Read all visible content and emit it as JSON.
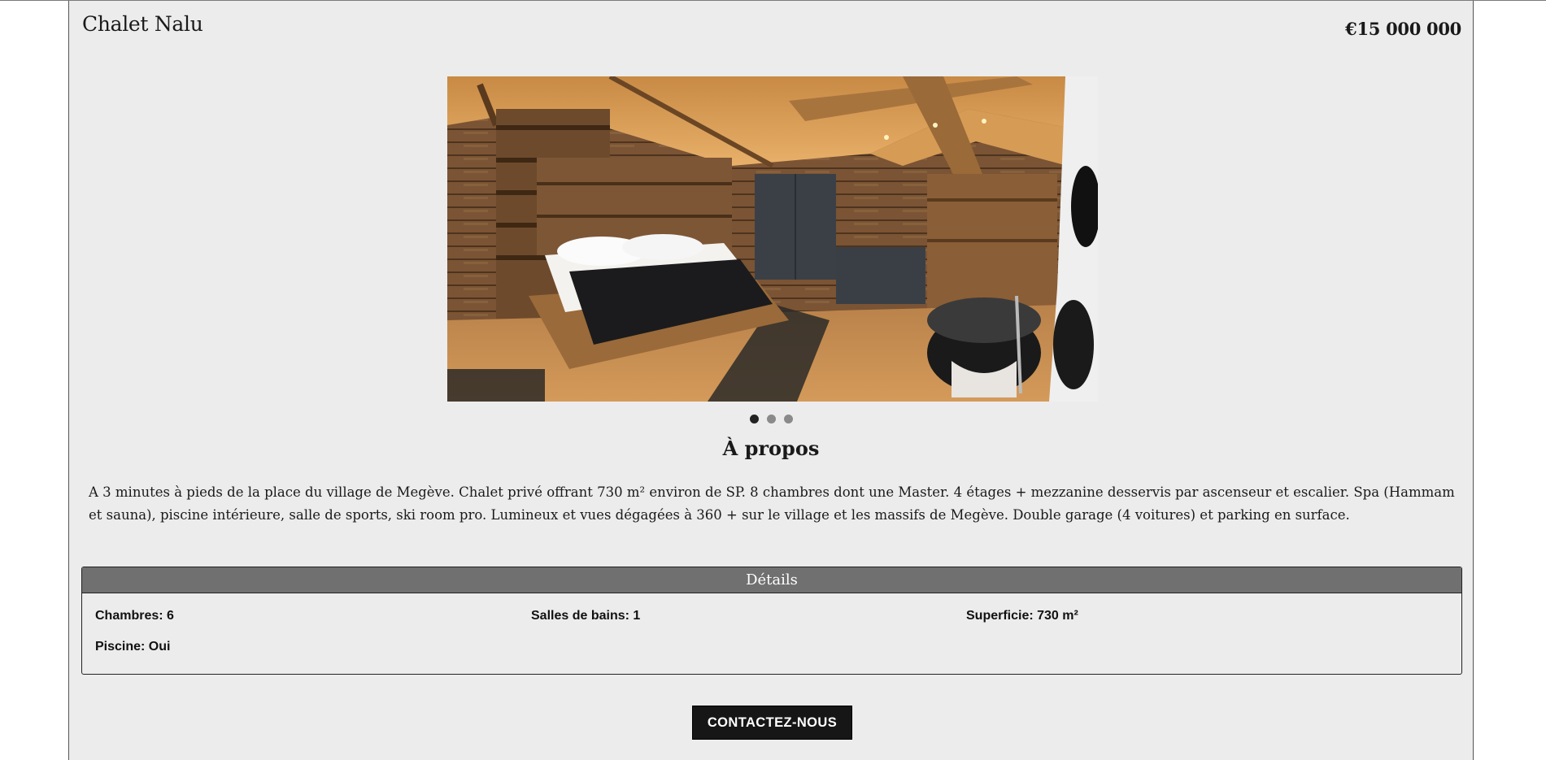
{
  "listing": {
    "title": "Chalet Nalu",
    "price": "€15 000 000"
  },
  "carousel": {
    "image": "chalet-bedroom-photo",
    "slides": 3,
    "active_slide": 1
  },
  "about": {
    "heading": "À propos",
    "text": "A 3 minutes à pieds de la place du village de Megève. Chalet privé offrant 730 m² environ de SP. 8 chambres dont une Master. 4 étages + mezzanine desservis par ascenseur et escalier. Spa (Hammam et sauna), piscine intérieure, salle de sports, ski room pro. Lumineux et vues dégagées à 360 + sur le village et les massifs de Megève. Double garage (4 voitures) et parking en surface."
  },
  "details": {
    "heading": "Détails",
    "items": [
      "Chambres: 6",
      "Salles de bains: 1",
      "Superficie: 730 m²",
      "Piscine: Oui"
    ]
  },
  "cta": {
    "label": "CONTACTEZ-NOUS"
  },
  "colors": {
    "card_bg": "#ececec",
    "details_header": "#707070",
    "button_bg": "#161616"
  }
}
